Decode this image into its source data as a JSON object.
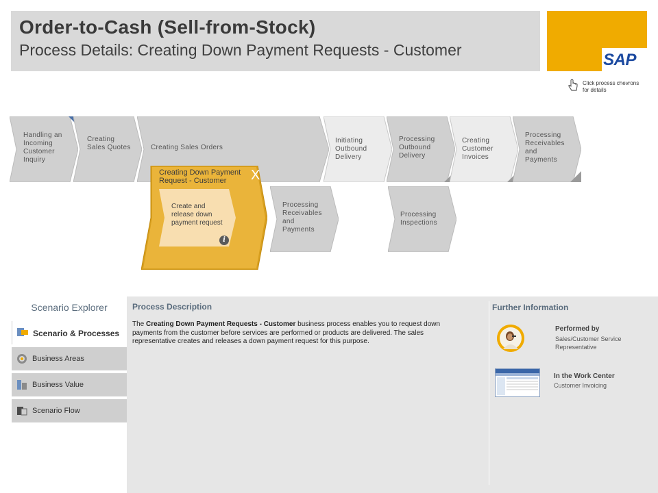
{
  "header": {
    "title": "Order-to-Cash (Sell-from-Stock)",
    "subtitle": "Process Details: Creating Down Payment Requests - Customer"
  },
  "logo": {
    "text": "SAP"
  },
  "hint": {
    "text": "Click process chevrons for details",
    "icon": "hand-pointer-icon"
  },
  "process_flow": {
    "top_row": [
      {
        "label": "Handling an Incoming Customer Inquiry"
      },
      {
        "label": "Creating Sales Quotes"
      },
      {
        "label": "Creating Sales Orders"
      },
      {
        "label": "Initiating Outbound Delivery"
      },
      {
        "label": "Processing Outbound Delivery"
      },
      {
        "label": "Creating Customer Invoices"
      },
      {
        "label": "Processing Receivables and Payments"
      }
    ],
    "active": {
      "title": "Creating Down Payment Request - Customer",
      "close": "X",
      "step": "Create and release down payment request",
      "info": "i"
    },
    "second_row": [
      {
        "label": "Processing Receivables and Payments"
      },
      {
        "label": "Processing Inspections"
      }
    ]
  },
  "explorer": {
    "title": "Scenario Explorer",
    "items": [
      {
        "label": "Scenario & Processes",
        "icon": "scenario-processes-icon",
        "active": true
      },
      {
        "label": "Business Areas",
        "icon": "business-areas-icon",
        "active": false
      },
      {
        "label": "Business Value",
        "icon": "business-value-icon",
        "active": false
      },
      {
        "label": "Scenario Flow",
        "icon": "scenario-flow-icon",
        "active": false
      }
    ]
  },
  "process_description": {
    "title": "Process Description",
    "prefix": "The ",
    "bold": "Creating Down Payment Requests - Customer",
    "suffix": " business process enables you to request down payments from the customer before services are performed or products are delivered. The sales representative creates and releases a down payment request for this purpose."
  },
  "further_info": {
    "title": "Further Information",
    "performed_by_label": "Performed by",
    "performed_by_value": "Sales/Customer Service Representative",
    "work_center_label": "In the Work Center",
    "work_center_value": "Customer Invoicing"
  },
  "colors": {
    "header_bg": "#d9d9d9",
    "brand_gold": "#f0ab00",
    "sap_blue": "#1c4aa0",
    "chevron_gray": "#d0d0d0",
    "active_gold": "#e9b23a",
    "panel_bg": "#e6e6e6",
    "section_title": "#5a6c7d"
  }
}
